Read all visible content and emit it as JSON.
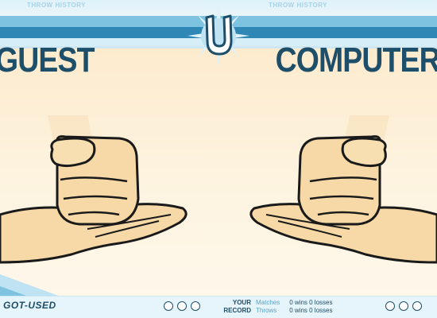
{
  "header": {
    "throw_history_left": "THROW HISTORY",
    "throw_history_right": "THROW HISTORY",
    "logo_letter": "U"
  },
  "players": {
    "guest": "GUEST",
    "computer": "COMPUTER"
  },
  "footer": {
    "brand": "GOT-USED",
    "record_title_1": "YOUR",
    "record_title_2": "RECORD",
    "matches_label": "Matches",
    "matches_value": "0 wins 0 losses",
    "throws_label": "Throws",
    "throws_value": "0 wins 0 losses"
  },
  "guest_rounds_won": 0,
  "computer_rounds_won": 0,
  "colors": {
    "navy": "#1d4e6a",
    "sky": "#7ec3e0",
    "blue": "#2e87b5",
    "skin": "#f6d9a6"
  },
  "icons": [
    "fist-on-palm-icon",
    "u-logo-icon",
    "round-indicator-icon"
  ]
}
